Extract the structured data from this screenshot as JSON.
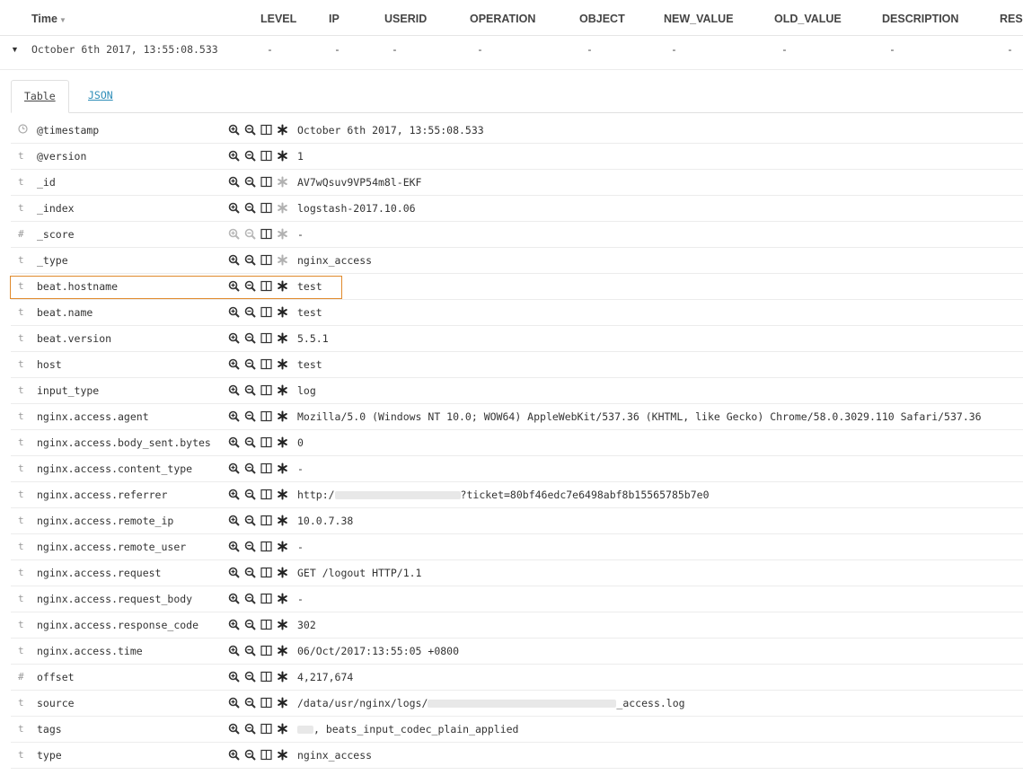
{
  "columns": {
    "time": "Time",
    "level": "LEVEL",
    "ip": "IP",
    "userid": "USERID",
    "operation": "OPERATION",
    "object": "OBJECT",
    "new_value": "NEW_VALUE",
    "old_value": "OLD_VALUE",
    "description": "DESCRIPTION",
    "result": "RESU"
  },
  "summary": {
    "time": "October 6th 2017, 13:55:08.533",
    "level": "-",
    "ip": "-",
    "userid": "-",
    "operation": "-",
    "object": "-",
    "new_value": "-",
    "old_value": "-",
    "description": "-",
    "result": "-"
  },
  "tabs": {
    "table": "Table",
    "json": "JSON"
  },
  "fields": [
    {
      "type": "clock",
      "name": "@timestamp",
      "value": "October 6th 2017, 13:55:08.533"
    },
    {
      "type": "t",
      "name": "@version",
      "value": "1"
    },
    {
      "type": "t",
      "name": "_id",
      "value": "AV7wQsuv9VP54m8l-EKF"
    },
    {
      "type": "t",
      "name": "_index",
      "value": "logstash-2017.10.06"
    },
    {
      "type": "#",
      "name": "_score",
      "value": " -"
    },
    {
      "type": "t",
      "name": "_type",
      "value": "nginx_access"
    },
    {
      "type": "t",
      "name": "beat.hostname",
      "value": "test"
    },
    {
      "type": "t",
      "name": "beat.name",
      "value": "test"
    },
    {
      "type": "t",
      "name": "beat.version",
      "value": "5.5.1"
    },
    {
      "type": "t",
      "name": "host",
      "value": "test"
    },
    {
      "type": "t",
      "name": "input_type",
      "value": "log"
    },
    {
      "type": "t",
      "name": "nginx.access.agent",
      "value": "Mozilla/5.0 (Windows NT 10.0; WOW64) AppleWebKit/537.36 (KHTML, like Gecko) Chrome/58.0.3029.110 Safari/537.36"
    },
    {
      "type": "t",
      "name": "nginx.access.body_sent.bytes",
      "value": "0"
    },
    {
      "type": "t",
      "name": "nginx.access.content_type",
      "value": "-"
    },
    {
      "type": "t",
      "name": "nginx.access.referrer",
      "value_prefix": "http:/",
      "value_suffix": "?ticket=80bf46edc7e6498abf8b15565785b7e0"
    },
    {
      "type": "t",
      "name": "nginx.access.remote_ip",
      "value": "10.0.7.38"
    },
    {
      "type": "t",
      "name": "nginx.access.remote_user",
      "value": "-"
    },
    {
      "type": "t",
      "name": "nginx.access.request",
      "value": "GET /logout HTTP/1.1"
    },
    {
      "type": "t",
      "name": "nginx.access.request_body",
      "value": "-"
    },
    {
      "type": "t",
      "name": "nginx.access.response_code",
      "value": "302"
    },
    {
      "type": "t",
      "name": "nginx.access.time",
      "value": "06/Oct/2017:13:55:05 +0800"
    },
    {
      "type": "#",
      "name": "offset",
      "value": "4,217,674"
    },
    {
      "type": "t",
      "name": "source",
      "value_prefix": "/data/usr/nginx/logs/",
      "value_suffix": "_access.log"
    },
    {
      "type": "t",
      "name": "tags",
      "value_prefix": "",
      "value_suffix": ", beats_input_codec_plain_applied"
    },
    {
      "type": "t",
      "name": "type",
      "value": "nginx_access"
    }
  ],
  "colors": {
    "highlight": "#e08a2c",
    "link": "#2d8db8"
  },
  "icons": [
    "zoom-in-icon",
    "zoom-out-icon",
    "toggle-column-icon",
    "filter-exists-icon"
  ]
}
